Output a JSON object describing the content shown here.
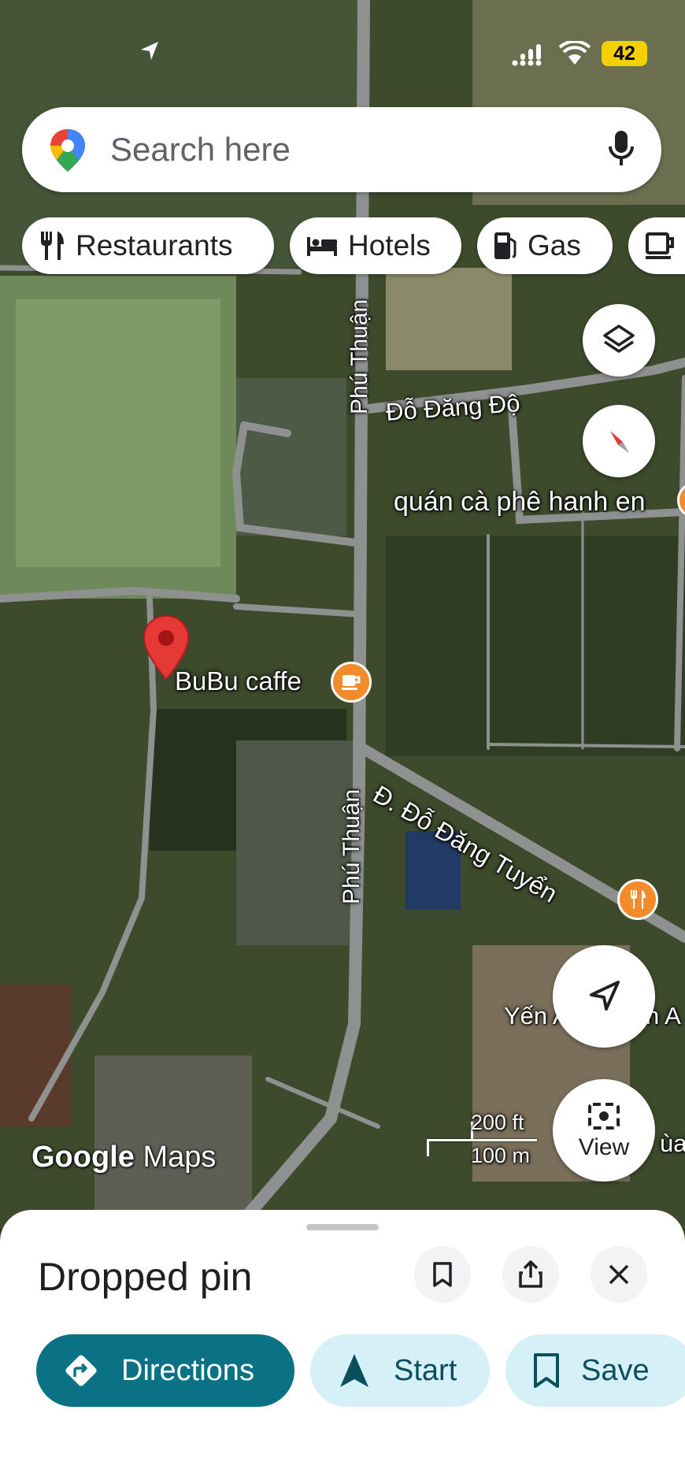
{
  "status_bar": {
    "battery": "42",
    "colors": {
      "battery_bg": "#f5d000"
    }
  },
  "search": {
    "placeholder": "Search here",
    "icons": [
      "maps-pin-icon",
      "mic-icon"
    ]
  },
  "chips": [
    {
      "label": "Restaurants",
      "icon": "fork-knife-icon"
    },
    {
      "label": "Hotels",
      "icon": "bed-icon"
    },
    {
      "label": "Gas",
      "icon": "gas-pump-icon"
    },
    {
      "label": "",
      "icon": "coffee-cup-icon"
    }
  ],
  "map": {
    "labels": {
      "road_phu_thuan": "Phú Thuận",
      "road_do_dang_do": "Đỗ Đăng Độ",
      "place_hanh_en": "quán cà phê hanh en",
      "place_bubu": "BuBu caffe",
      "road_do_dang_tuyen": "Đ. Đỗ Đăng Tuyển",
      "place_yen": "Yến A",
      "place_yen_suffix": "h A",
      "place_partial": "ùa"
    },
    "scale": {
      "feet": "200 ft",
      "meters": "100 m"
    },
    "attribution": {
      "google": "Google",
      "maps": "Maps"
    },
    "view_button": "View",
    "colors": {
      "pin": "#e53935",
      "poi": "#f28b2c"
    }
  },
  "sheet": {
    "title": "Dropped pin",
    "actions": [
      {
        "label": "Directions",
        "icon": "directions-icon"
      },
      {
        "label": "Start",
        "icon": "navigation-arrow-icon"
      },
      {
        "label": "Save",
        "icon": "bookmark-icon"
      }
    ],
    "colors": {
      "primary": "#0b7285",
      "secondary_bg": "#d6f0f7",
      "secondary_text": "#0b4f5c"
    }
  }
}
